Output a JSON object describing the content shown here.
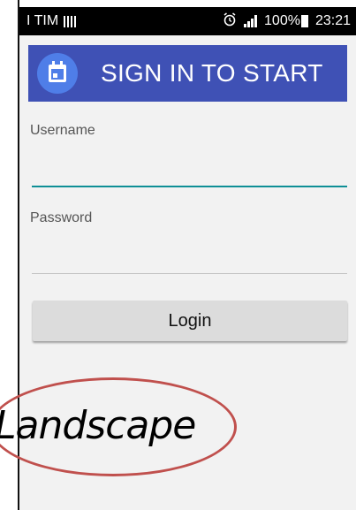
{
  "status_bar": {
    "carrier": "I TIM",
    "alarm_icon": "alarm-clock-icon",
    "signal_icon": "signal-strength-icon",
    "battery": "100%",
    "time": "23:21"
  },
  "toolbar": {
    "app_icon": "calendar-icon",
    "title": "SIGN IN TO START",
    "color": "#3f51b5",
    "icon_color": "#4f7ee8"
  },
  "form": {
    "username_label": "Username",
    "username_value": "",
    "password_label": "Password",
    "password_value": "",
    "login_label": "Login",
    "accent_color": "#0f8f96"
  },
  "annotation": {
    "caption": "Landscape",
    "ellipse_color": "#c0504d"
  }
}
